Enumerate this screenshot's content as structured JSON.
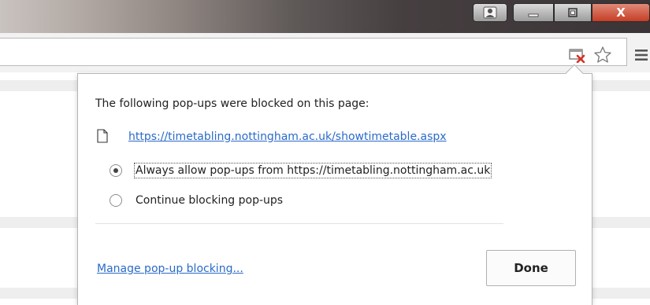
{
  "window": {
    "close_glyph": "X"
  },
  "bubble": {
    "heading": "The following pop-ups were blocked on this page:",
    "blocked_popup_url": "https://timetabling.nottingham.ac.uk/showtimetable.aspx",
    "options": [
      {
        "label": "Always allow pop-ups from https://timetabling.nottingham.ac.uk",
        "checked": true
      },
      {
        "label": "Continue blocking pop-ups",
        "checked": false
      }
    ],
    "manage_link": "Manage pop-up blocking...",
    "done_label": "Done"
  },
  "icons": {
    "blocked": "popup-blocked-icon",
    "bookmark": "star-icon",
    "menu": "hamburger-menu-icon",
    "document": "document-icon",
    "user": "user-icon",
    "minimize": "minimize-icon",
    "maximize": "maximize-icon"
  },
  "colors": {
    "link": "#2a6ac9",
    "blocked_x": "#d93025",
    "close_button": "#c63d25"
  }
}
